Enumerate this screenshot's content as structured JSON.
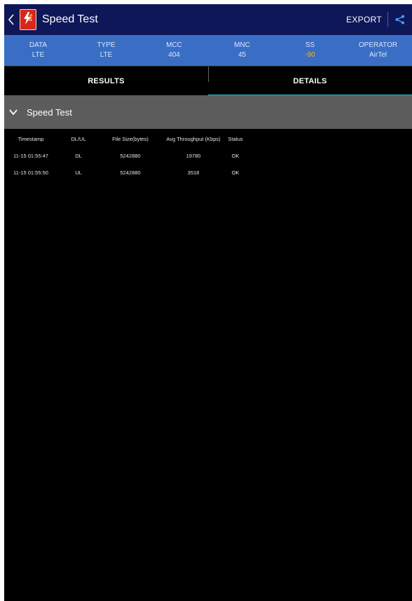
{
  "app": {
    "title": "Speed Test",
    "export_label": "EXPORT",
    "logo_badge": "Pro"
  },
  "info": [
    {
      "label": "DATA",
      "value": "LTE"
    },
    {
      "label": "TYPE",
      "value": "LTE"
    },
    {
      "label": "MCC",
      "value": "404"
    },
    {
      "label": "MNC",
      "value": "45"
    },
    {
      "label": "SS",
      "value": "-90"
    },
    {
      "label": "OPERATOR",
      "value": "AirTel"
    }
  ],
  "tabs": [
    {
      "label": "RESULTS",
      "active": false
    },
    {
      "label": "DETAILS",
      "active": true
    }
  ],
  "section": {
    "title": "Speed Test"
  },
  "table": {
    "headers": [
      "Timestamp",
      "DL/UL",
      "File Size(bytes)",
      "Avg Throughput (Kbps)",
      "Status"
    ],
    "rows": [
      [
        "11-15 01:55:47",
        "DL",
        "5242880",
        "19780",
        "OK"
      ],
      [
        "11-15 01:55:50",
        "UL",
        "5242880",
        "3518",
        "OK"
      ]
    ]
  },
  "colors": {
    "title_bar": "#0e1757",
    "info_bar": "#3a6ec4",
    "tab_indicator": "#29b5c9",
    "ss_value": "#f2b13a",
    "section_bg": "#5c5c5c"
  },
  "icons": {
    "back": "chevron-left-icon",
    "share": "share-icon",
    "collapse": "chevron-down-icon"
  }
}
